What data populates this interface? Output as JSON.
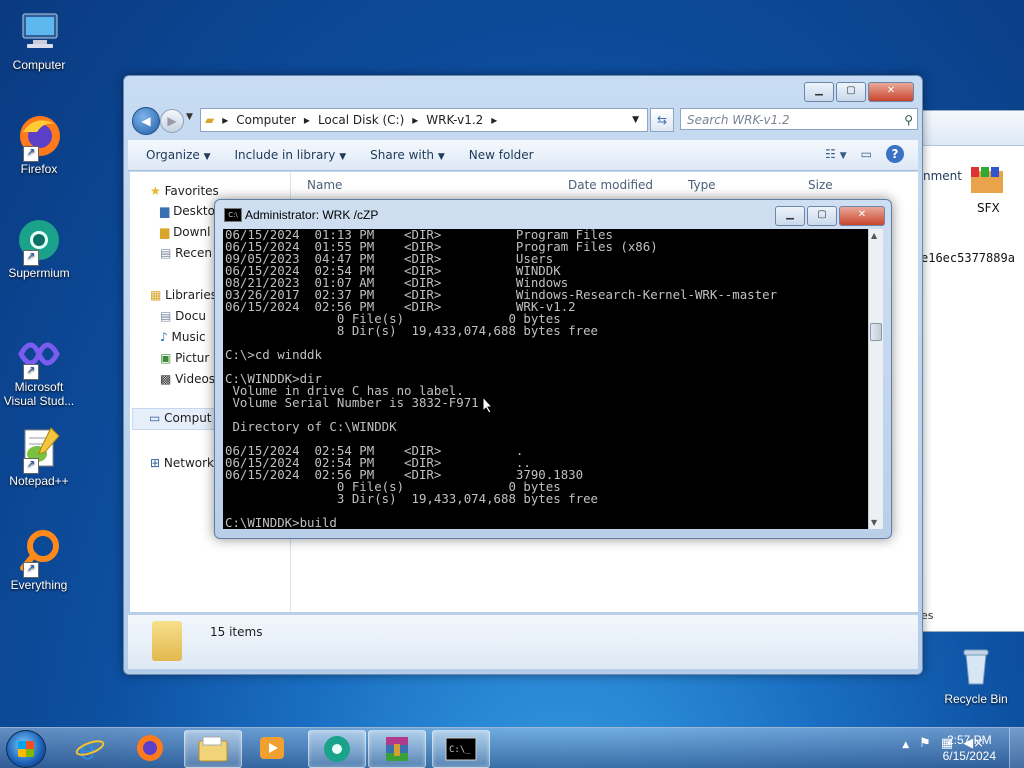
{
  "desktop": {
    "icons": [
      {
        "label": "Computer",
        "icon": "computer-icon"
      },
      {
        "label": "Firefox",
        "icon": "firefox-icon"
      },
      {
        "label": "Supermium",
        "icon": "supermium-icon"
      },
      {
        "label": "Microsoft Visual Stud...",
        "icon": "visual-studio-icon"
      },
      {
        "label": "Notepad++",
        "icon": "notepadpp-icon"
      },
      {
        "label": "Everything",
        "icon": "everything-icon"
      },
      {
        "label": "Recycle Bin",
        "icon": "recycle-bin-icon"
      }
    ]
  },
  "explorer": {
    "breadcrumb": [
      "Computer",
      "Local Disk (C:)",
      "WRK-v1.2"
    ],
    "search_placeholder": "Search WRK-v1.2",
    "toolbar": {
      "organize": "Organize",
      "include_in_library": "Include in library",
      "share_with": "Share with",
      "new_folder": "New folder"
    },
    "nav": {
      "favorites": "Favorites",
      "desktop": "Deskto",
      "downloads": "Downl",
      "recent": "Recen",
      "libraries": "Libraries",
      "documents": "Docu",
      "music": "Music",
      "pictures": "Pictur",
      "videos": "Videos",
      "computer": "Comput",
      "network": "Network"
    },
    "columns": [
      "Name",
      "Date modified",
      "Type",
      "Size"
    ],
    "status": "15 items"
  },
  "background_window": {
    "toolbar_text": "nment",
    "sfx_label": "SFX",
    "hash_fragment": "e16ec5377889a",
    "status_fragment": "es"
  },
  "console": {
    "title": "Administrator:  WRK /cZP",
    "lines": [
      "06/15/2024  01:13 PM    <DIR>          Program Files",
      "06/15/2024  01:55 PM    <DIR>          Program Files (x86)",
      "09/05/2023  04:47 PM    <DIR>          Users",
      "06/15/2024  02:54 PM    <DIR>          WINDDK",
      "08/21/2023  01:07 AM    <DIR>          Windows",
      "03/26/2017  02:37 PM    <DIR>          Windows-Research-Kernel-WRK--master",
      "06/15/2024  02:56 PM    <DIR>          WRK-v1.2",
      "               0 File(s)              0 bytes",
      "               8 Dir(s)  19,433,074,688 bytes free",
      "",
      "C:\\>cd winddk",
      "",
      "C:\\WINDDK>dir",
      " Volume in drive C has no label.",
      " Volume Serial Number is 3832-F971",
      "",
      " Directory of C:\\WINDDK",
      "",
      "06/15/2024  02:54 PM    <DIR>          .",
      "06/15/2024  02:54 PM    <DIR>          ..",
      "06/15/2024  02:56 PM    <DIR>          3790.1830",
      "               0 File(s)              0 bytes",
      "               3 Dir(s)  19,433,074,688 bytes free",
      "",
      "C:\\WINDDK>build"
    ]
  },
  "taskbar": {
    "apps": [
      "internet-explorer-icon",
      "firefox-icon",
      "explorer-icon",
      "media-player-icon",
      "supermium-icon",
      "winrar-icon",
      "cmd-icon"
    ],
    "time": "2:57 PM",
    "date": "6/15/2024"
  }
}
